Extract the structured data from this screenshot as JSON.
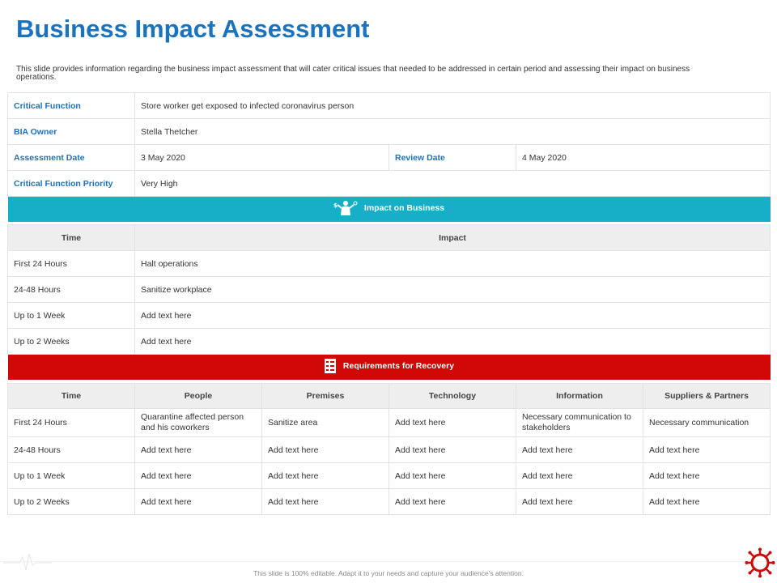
{
  "title": "Business Impact Assessment",
  "description": "This slide provides information regarding the business impact assessment that will cater critical issues that needed to be addressed in certain period and assessing their impact on business operations.",
  "info": {
    "critical_function_label": "Critical Function",
    "critical_function_value": "Store worker get exposed to infected coronavirus person",
    "bia_owner_label": "BIA Owner",
    "bia_owner_value": "Stella Thetcher",
    "assessment_date_label": "Assessment Date",
    "assessment_date_value": "3 May 2020",
    "review_date_label": "Review Date",
    "review_date_value": "4 May 2020",
    "priority_label": "Critical Function Priority",
    "priority_value": "Very High"
  },
  "impact": {
    "banner": "Impact on Business",
    "banner_icon": "business-person-icon",
    "headers": [
      "Time",
      "Impact"
    ],
    "rows": [
      [
        "First 24 Hours",
        "Halt operations"
      ],
      [
        "24-48 Hours",
        "Sanitize workplace"
      ],
      [
        "Up to 1 Week",
        "Add text here"
      ],
      [
        "Up to 2 Weeks",
        "Add text here"
      ]
    ]
  },
  "recovery": {
    "banner": "Requirements for Recovery",
    "banner_icon": "checklist-icon",
    "headers": [
      "Time",
      "People",
      "Premises",
      "Technology",
      "Information",
      "Suppliers & Partners"
    ],
    "rows": [
      [
        "First 24 Hours",
        "Quarantine affected person and his coworkers",
        "Sanitize area",
        "Add text here",
        "Necessary communication to stakeholders",
        "Necessary communication"
      ],
      [
        "24-48 Hours",
        "Add text here",
        "Add text here",
        "Add text here",
        "Add text here",
        "Add text here"
      ],
      [
        "Up to 1 Week",
        "Add text here",
        "Add text here",
        "Add text here",
        "Add text here",
        "Add text here"
      ],
      [
        "Up to 2 Weeks",
        "Add text here",
        "Add text here",
        "Add text here",
        "Add text here",
        "Add text here"
      ]
    ]
  },
  "footer": "This slide is 100% editable. Adapt it to your needs and capture your audience's attention.",
  "colors": {
    "title": "#1a73c1",
    "teal_banner": "#17aec7",
    "red_banner": "#d20808"
  }
}
